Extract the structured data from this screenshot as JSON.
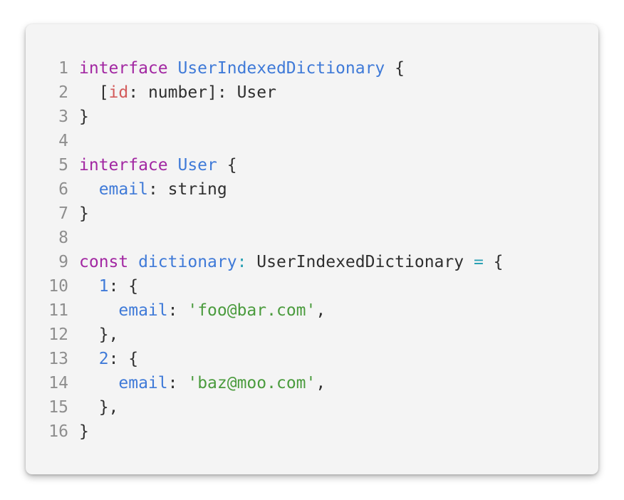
{
  "colors": {
    "keyword": "#a227a2",
    "type": "#3f7ad8",
    "property": "#3f7ad8",
    "string": "#4a9b3d",
    "operator": "#2aa1b3",
    "index_param": "#d35b5b",
    "line_number": "#8e8e8e",
    "text": "#2f2f2f",
    "card_bg": "#f4f4f4"
  },
  "code": {
    "lines": [
      {
        "num": "1",
        "tokens": [
          {
            "t": "interface",
            "c": "kw"
          },
          {
            "t": " ",
            "c": "plain"
          },
          {
            "t": "UserIndexedDictionary",
            "c": "ty"
          },
          {
            "t": " {",
            "c": "pn"
          }
        ]
      },
      {
        "num": "2",
        "tokens": [
          {
            "t": "  [",
            "c": "pn"
          },
          {
            "t": "id",
            "c": "idx"
          },
          {
            "t": ": number]: User",
            "c": "plain"
          }
        ]
      },
      {
        "num": "3",
        "tokens": [
          {
            "t": "}",
            "c": "pn"
          }
        ]
      },
      {
        "num": "4",
        "tokens": [
          {
            "t": "",
            "c": "plain"
          }
        ]
      },
      {
        "num": "5",
        "tokens": [
          {
            "t": "interface",
            "c": "kw"
          },
          {
            "t": " ",
            "c": "plain"
          },
          {
            "t": "User",
            "c": "ty"
          },
          {
            "t": " {",
            "c": "pn"
          }
        ]
      },
      {
        "num": "6",
        "tokens": [
          {
            "t": "  ",
            "c": "plain"
          },
          {
            "t": "email",
            "c": "pr"
          },
          {
            "t": ": string",
            "c": "plain"
          }
        ]
      },
      {
        "num": "7",
        "tokens": [
          {
            "t": "}",
            "c": "pn"
          }
        ]
      },
      {
        "num": "8",
        "tokens": [
          {
            "t": "",
            "c": "plain"
          }
        ]
      },
      {
        "num": "9",
        "tokens": [
          {
            "t": "const",
            "c": "kw"
          },
          {
            "t": " ",
            "c": "plain"
          },
          {
            "t": "dictionary",
            "c": "ty"
          },
          {
            "t": ": ",
            "c": "op"
          },
          {
            "t": "UserIndexedDictionary",
            "c": "plain"
          },
          {
            "t": " ",
            "c": "plain"
          },
          {
            "t": "=",
            "c": "op"
          },
          {
            "t": " {",
            "c": "pn"
          }
        ]
      },
      {
        "num": "10",
        "tokens": [
          {
            "t": "  ",
            "c": "plain"
          },
          {
            "t": "1",
            "c": "nm"
          },
          {
            "t": ": {",
            "c": "pn"
          }
        ]
      },
      {
        "num": "11",
        "tokens": [
          {
            "t": "    ",
            "c": "plain"
          },
          {
            "t": "email",
            "c": "pr"
          },
          {
            "t": ": ",
            "c": "pn"
          },
          {
            "t": "'foo@bar.com'",
            "c": "str"
          },
          {
            "t": ",",
            "c": "pn"
          }
        ]
      },
      {
        "num": "12",
        "tokens": [
          {
            "t": "  },",
            "c": "pn"
          }
        ]
      },
      {
        "num": "13",
        "tokens": [
          {
            "t": "  ",
            "c": "plain"
          },
          {
            "t": "2",
            "c": "nm"
          },
          {
            "t": ": {",
            "c": "pn"
          }
        ]
      },
      {
        "num": "14",
        "tokens": [
          {
            "t": "    ",
            "c": "plain"
          },
          {
            "t": "email",
            "c": "pr"
          },
          {
            "t": ": ",
            "c": "pn"
          },
          {
            "t": "'baz@moo.com'",
            "c": "str"
          },
          {
            "t": ",",
            "c": "pn"
          }
        ]
      },
      {
        "num": "15",
        "tokens": [
          {
            "t": "  },",
            "c": "pn"
          }
        ]
      },
      {
        "num": "16",
        "tokens": [
          {
            "t": "}",
            "c": "pn"
          }
        ]
      }
    ]
  }
}
